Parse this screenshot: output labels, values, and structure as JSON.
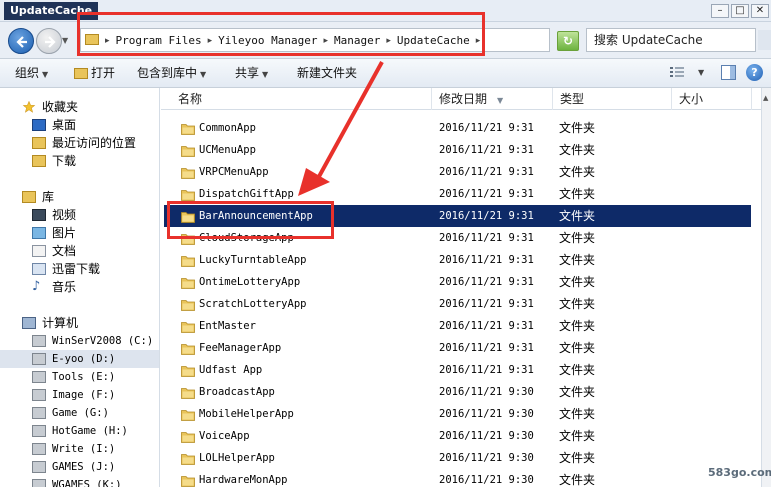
{
  "window": {
    "title": "UpdateCache",
    "minimize": "–",
    "maximize": "□",
    "close": "✕"
  },
  "address_bar": {
    "crumbs": [
      "Program Files",
      "Yileyoo Manager",
      "Manager",
      "UpdateCache"
    ]
  },
  "search": {
    "placeholder": "搜索 UpdateCache"
  },
  "toolbar": {
    "organize": "组织",
    "open": "打开",
    "include_library": "包含到库中",
    "share": "共享",
    "new_folder": "新建文件夹"
  },
  "nav": {
    "favorites": "收藏夹",
    "desktop": "桌面",
    "recent": "最近访问的位置",
    "downloads": "下载",
    "libraries": "库",
    "videos": "视频",
    "pictures": "图片",
    "documents": "文档",
    "thunder": "迅雷下载",
    "music": "音乐",
    "computer": "计算机",
    "drives": [
      {
        "label": "WinSerV2008 (C:)"
      },
      {
        "label": "E-yoo (D:)",
        "selected": true
      },
      {
        "label": "Tools (E:)"
      },
      {
        "label": "Image (F:)"
      },
      {
        "label": "Game (G:)"
      },
      {
        "label": "HotGame (H:)"
      },
      {
        "label": "Write (I:)"
      },
      {
        "label": "GAMES (J:)"
      },
      {
        "label": "WGAMES (K:)"
      }
    ]
  },
  "columns": {
    "name": "名称",
    "modified": "修改日期",
    "type": "类型",
    "size": "大小"
  },
  "files": [
    {
      "name": "CommonApp",
      "date": "2016/11/21 9:31",
      "type": "文件夹"
    },
    {
      "name": "UCMenuApp",
      "date": "2016/11/21 9:31",
      "type": "文件夹"
    },
    {
      "name": "VRPCMenuApp",
      "date": "2016/11/21 9:31",
      "type": "文件夹"
    },
    {
      "name": "DispatchGiftApp",
      "date": "2016/11/21 9:31",
      "type": "文件夹"
    },
    {
      "name": "BarAnnouncementApp",
      "date": "2016/11/21 9:31",
      "type": "文件夹",
      "selected": true
    },
    {
      "name": "CloudStorageApp",
      "date": "2016/11/21 9:31",
      "type": "文件夹"
    },
    {
      "name": "LuckyTurntableApp",
      "date": "2016/11/21 9:31",
      "type": "文件夹"
    },
    {
      "name": "OntimeLotteryApp",
      "date": "2016/11/21 9:31",
      "type": "文件夹"
    },
    {
      "name": "ScratchLotteryApp",
      "date": "2016/11/21 9:31",
      "type": "文件夹"
    },
    {
      "name": "EntMaster",
      "date": "2016/11/21 9:31",
      "type": "文件夹"
    },
    {
      "name": "FeeManagerApp",
      "date": "2016/11/21 9:31",
      "type": "文件夹"
    },
    {
      "name": "Udfast App",
      "date": "2016/11/21 9:31",
      "type": "文件夹"
    },
    {
      "name": "BroadcastApp",
      "date": "2016/11/21 9:30",
      "type": "文件夹"
    },
    {
      "name": "MobileHelperApp",
      "date": "2016/11/21 9:30",
      "type": "文件夹"
    },
    {
      "name": "VoiceApp",
      "date": "2016/11/21 9:30",
      "type": "文件夹"
    },
    {
      "name": "LOLHelperApp",
      "date": "2016/11/21 9:30",
      "type": "文件夹"
    },
    {
      "name": "HardwareMonApp",
      "date": "2016/11/21 9:30",
      "type": "文件夹"
    }
  ],
  "watermark": "583go.com",
  "colors": {
    "selection": "#0e2a68",
    "annotation": "#e8312b",
    "folder": "#e9c45a"
  }
}
